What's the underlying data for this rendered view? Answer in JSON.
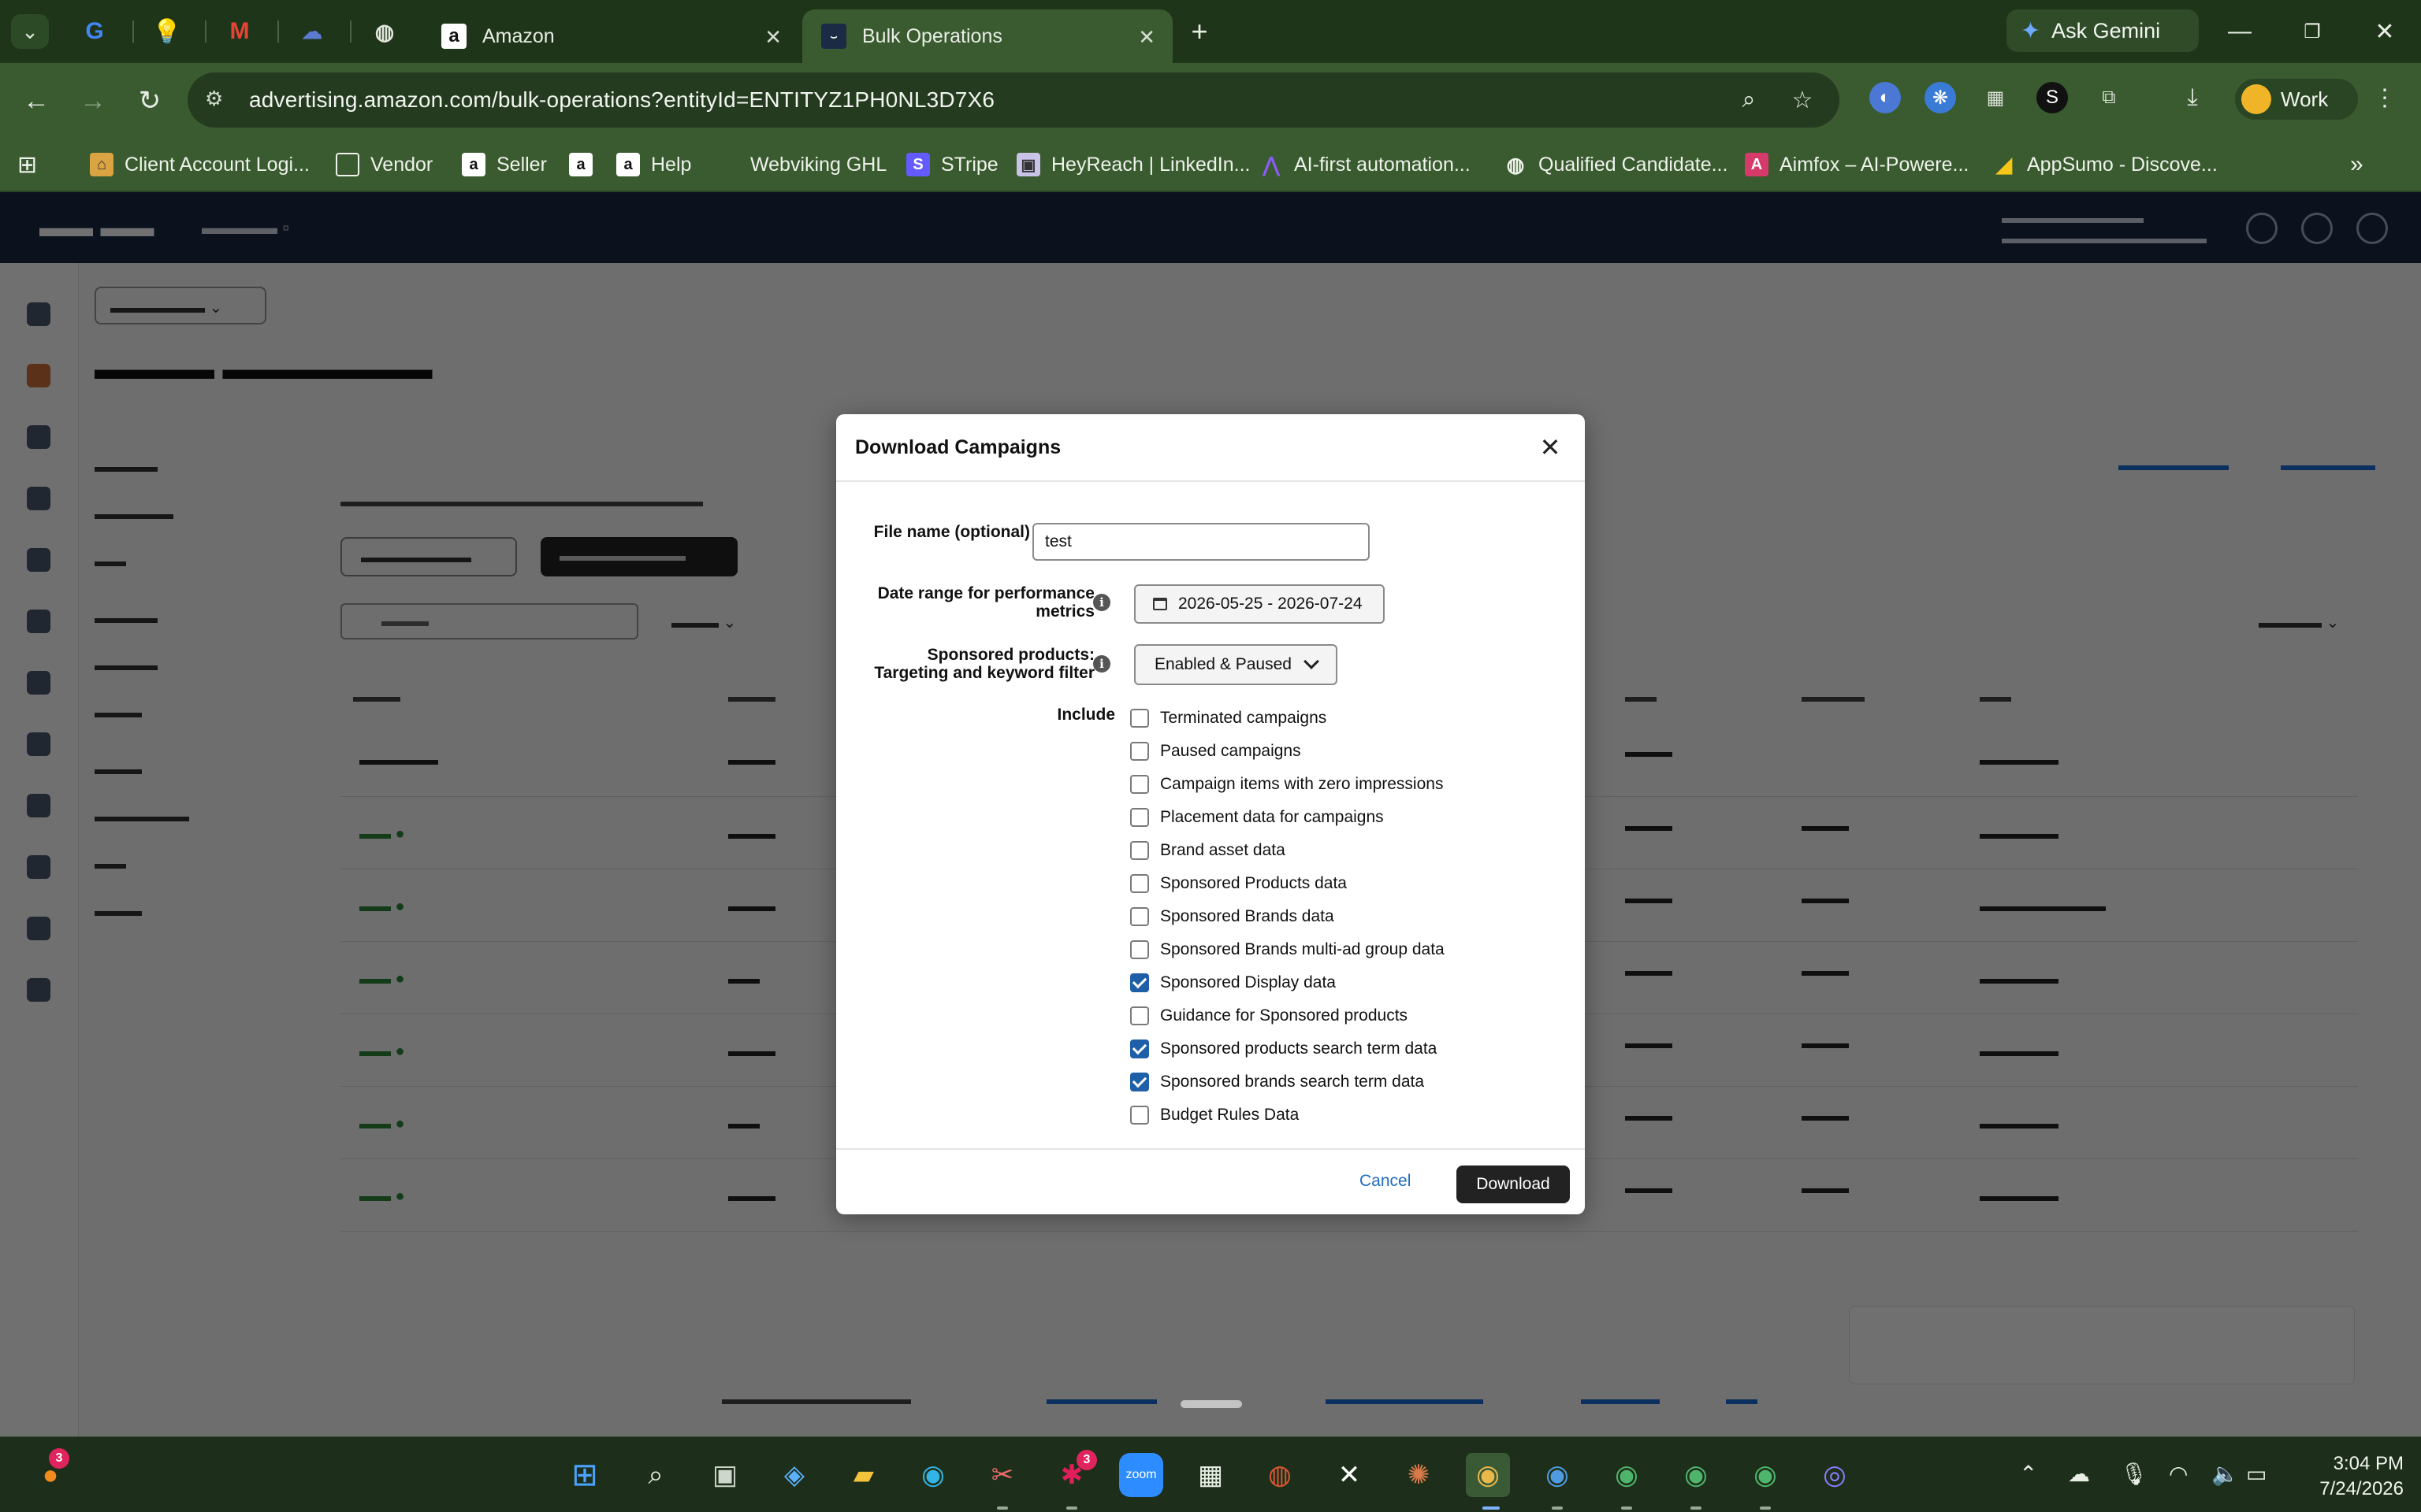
{
  "browser": {
    "tabs": [
      {
        "label": "Amazon",
        "active": false
      },
      {
        "label": "Bulk Operations",
        "active": true
      }
    ],
    "ask_gemini": "Ask Gemini",
    "url": "advertising.amazon.com/bulk-operations?entityId=ENTITYZ1PH0NL3D7X6",
    "profile": "Work",
    "bookmarks": [
      "Client Account Logi...",
      "Vendor",
      "Seller",
      "Help",
      "Webviking GHL",
      "STripe",
      "HeyReach | LinkedIn...",
      "AI-first automation...",
      "Qualified Candidate...",
      "Aimfox – AI-Powere...",
      "AppSumo - Discove..."
    ]
  },
  "dialog": {
    "title": "Download Campaigns",
    "file_name_label": "File name (optional)",
    "file_name_value": "test",
    "date_range_label_1": "Date range for performance",
    "date_range_label_2": "metrics",
    "date_range_value": "2026-05-25 - 2026-07-24",
    "filter_label_1": "Sponsored products:",
    "filter_label_2": "Targeting and keyword filter",
    "filter_value": "Enabled & Paused",
    "include_label": "Include",
    "include_options": [
      {
        "label": "Terminated campaigns",
        "checked": false
      },
      {
        "label": "Paused campaigns",
        "checked": false
      },
      {
        "label": "Campaign items with zero impressions",
        "checked": false
      },
      {
        "label": "Placement data for campaigns",
        "checked": false
      },
      {
        "label": "Brand asset data",
        "checked": false
      },
      {
        "label": "Sponsored Products data",
        "checked": false
      },
      {
        "label": "Sponsored Brands data",
        "checked": false
      },
      {
        "label": "Sponsored Brands multi-ad group data",
        "checked": false
      },
      {
        "label": "Sponsored Display data",
        "checked": true
      },
      {
        "label": "Guidance for Sponsored products",
        "checked": false
      },
      {
        "label": "Sponsored products search term data",
        "checked": true
      },
      {
        "label": "Sponsored brands search term data",
        "checked": true
      },
      {
        "label": "Budget Rules Data",
        "checked": false
      }
    ],
    "cancel_label": "Cancel",
    "download_label": "Download"
  },
  "taskbar": {
    "time": "3:04 PM",
    "date": "7/24/2026"
  },
  "colors": {
    "chrome_dark": "#1f3519",
    "chrome": "#3a5a30",
    "checkbox_checked": "#1e5fa8",
    "link": "#1f6cc0"
  }
}
